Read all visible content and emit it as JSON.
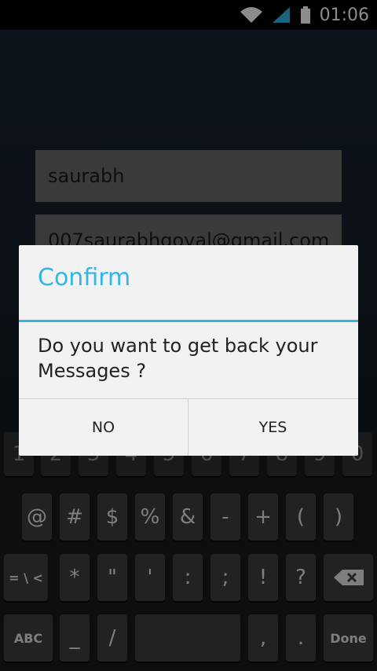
{
  "status": {
    "time": "01:06"
  },
  "form": {
    "name_value": "saurabh",
    "email_value": "007saurabhgoyal@gmail.com"
  },
  "dialog": {
    "title": "Confirm",
    "message": "Do you want to get back  your Messages ?",
    "no_label": "NO",
    "yes_label": "YES"
  },
  "keyboard": {
    "number_row": [
      "1",
      "2",
      "3",
      "4",
      "5",
      "6",
      "7",
      "8",
      "9",
      "0"
    ],
    "row2": [
      "@",
      "#",
      "$",
      "%",
      "&",
      "-",
      "+",
      "(",
      ")"
    ],
    "row3": [
      "= \\ <",
      "*",
      "\"",
      "'",
      ":",
      ";",
      "!",
      "?"
    ],
    "row4_left": "ABC",
    "row4_underscore": "_",
    "row4_slash": "/",
    "row4_comma": ",",
    "row4_dot": ".",
    "row4_done": "Done"
  },
  "colors": {
    "accent": "#33b5e5"
  }
}
